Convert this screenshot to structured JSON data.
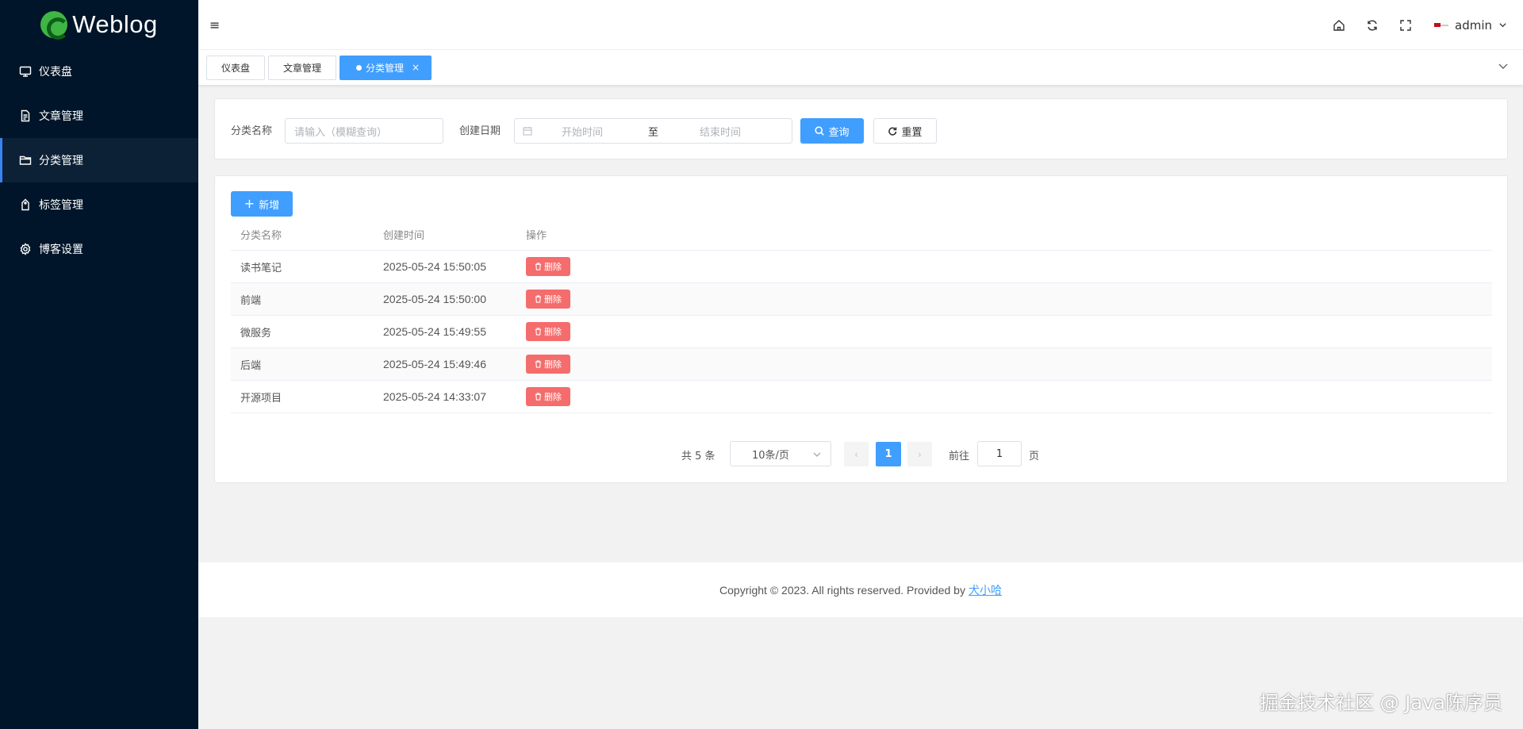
{
  "app": {
    "logo_text": "Weblog"
  },
  "sidebar": {
    "items": [
      {
        "label": "仪表盘",
        "icon": "monitor-icon"
      },
      {
        "label": "文章管理",
        "icon": "document-icon"
      },
      {
        "label": "分类管理",
        "icon": "folder-icon",
        "active": true
      },
      {
        "label": "标签管理",
        "icon": "tag-icon"
      },
      {
        "label": "博客设置",
        "icon": "gear-icon"
      }
    ]
  },
  "header": {
    "username": "admin"
  },
  "tabs": [
    {
      "label": "仪表盘"
    },
    {
      "label": "文章管理"
    },
    {
      "label": "分类管理",
      "active": true,
      "close": "×"
    }
  ],
  "search": {
    "name_label": "分类名称",
    "name_placeholder": "请输入（模糊查询）",
    "date_label": "创建日期",
    "start_placeholder": "开始时间",
    "separator": "至",
    "end_placeholder": "结束时间",
    "query_button": "查询",
    "reset_button": "重置"
  },
  "list": {
    "add_button": "新增",
    "columns": [
      "分类名称",
      "创建时间",
      "操作"
    ],
    "rows": [
      {
        "name": "读书笔记",
        "created": "2025-05-24 15:50:05",
        "action": "删除"
      },
      {
        "name": "前端",
        "created": "2025-05-24 15:50:00",
        "action": "删除"
      },
      {
        "name": "微服务",
        "created": "2025-05-24 15:49:55",
        "action": "删除"
      },
      {
        "name": "后端",
        "created": "2025-05-24 15:49:46",
        "action": "删除"
      },
      {
        "name": "开源项目",
        "created": "2025-05-24 14:33:07",
        "action": "删除"
      }
    ]
  },
  "pagination": {
    "total": "共 5 条",
    "page_size": "10条/页",
    "prev": "‹",
    "current": "1",
    "next": "›",
    "goto_label": "前往",
    "goto_value": "1",
    "page_suffix": "页"
  },
  "footer": {
    "copyright": "Copyright © 2023. All rights reserved. Provided by",
    "author": "犬小哈"
  },
  "watermark": "掘金技术社区 @ Java陈序员",
  "colors": {
    "sidebar_bg": "#001529",
    "primary": "#409eff",
    "danger": "#f56c6c"
  }
}
